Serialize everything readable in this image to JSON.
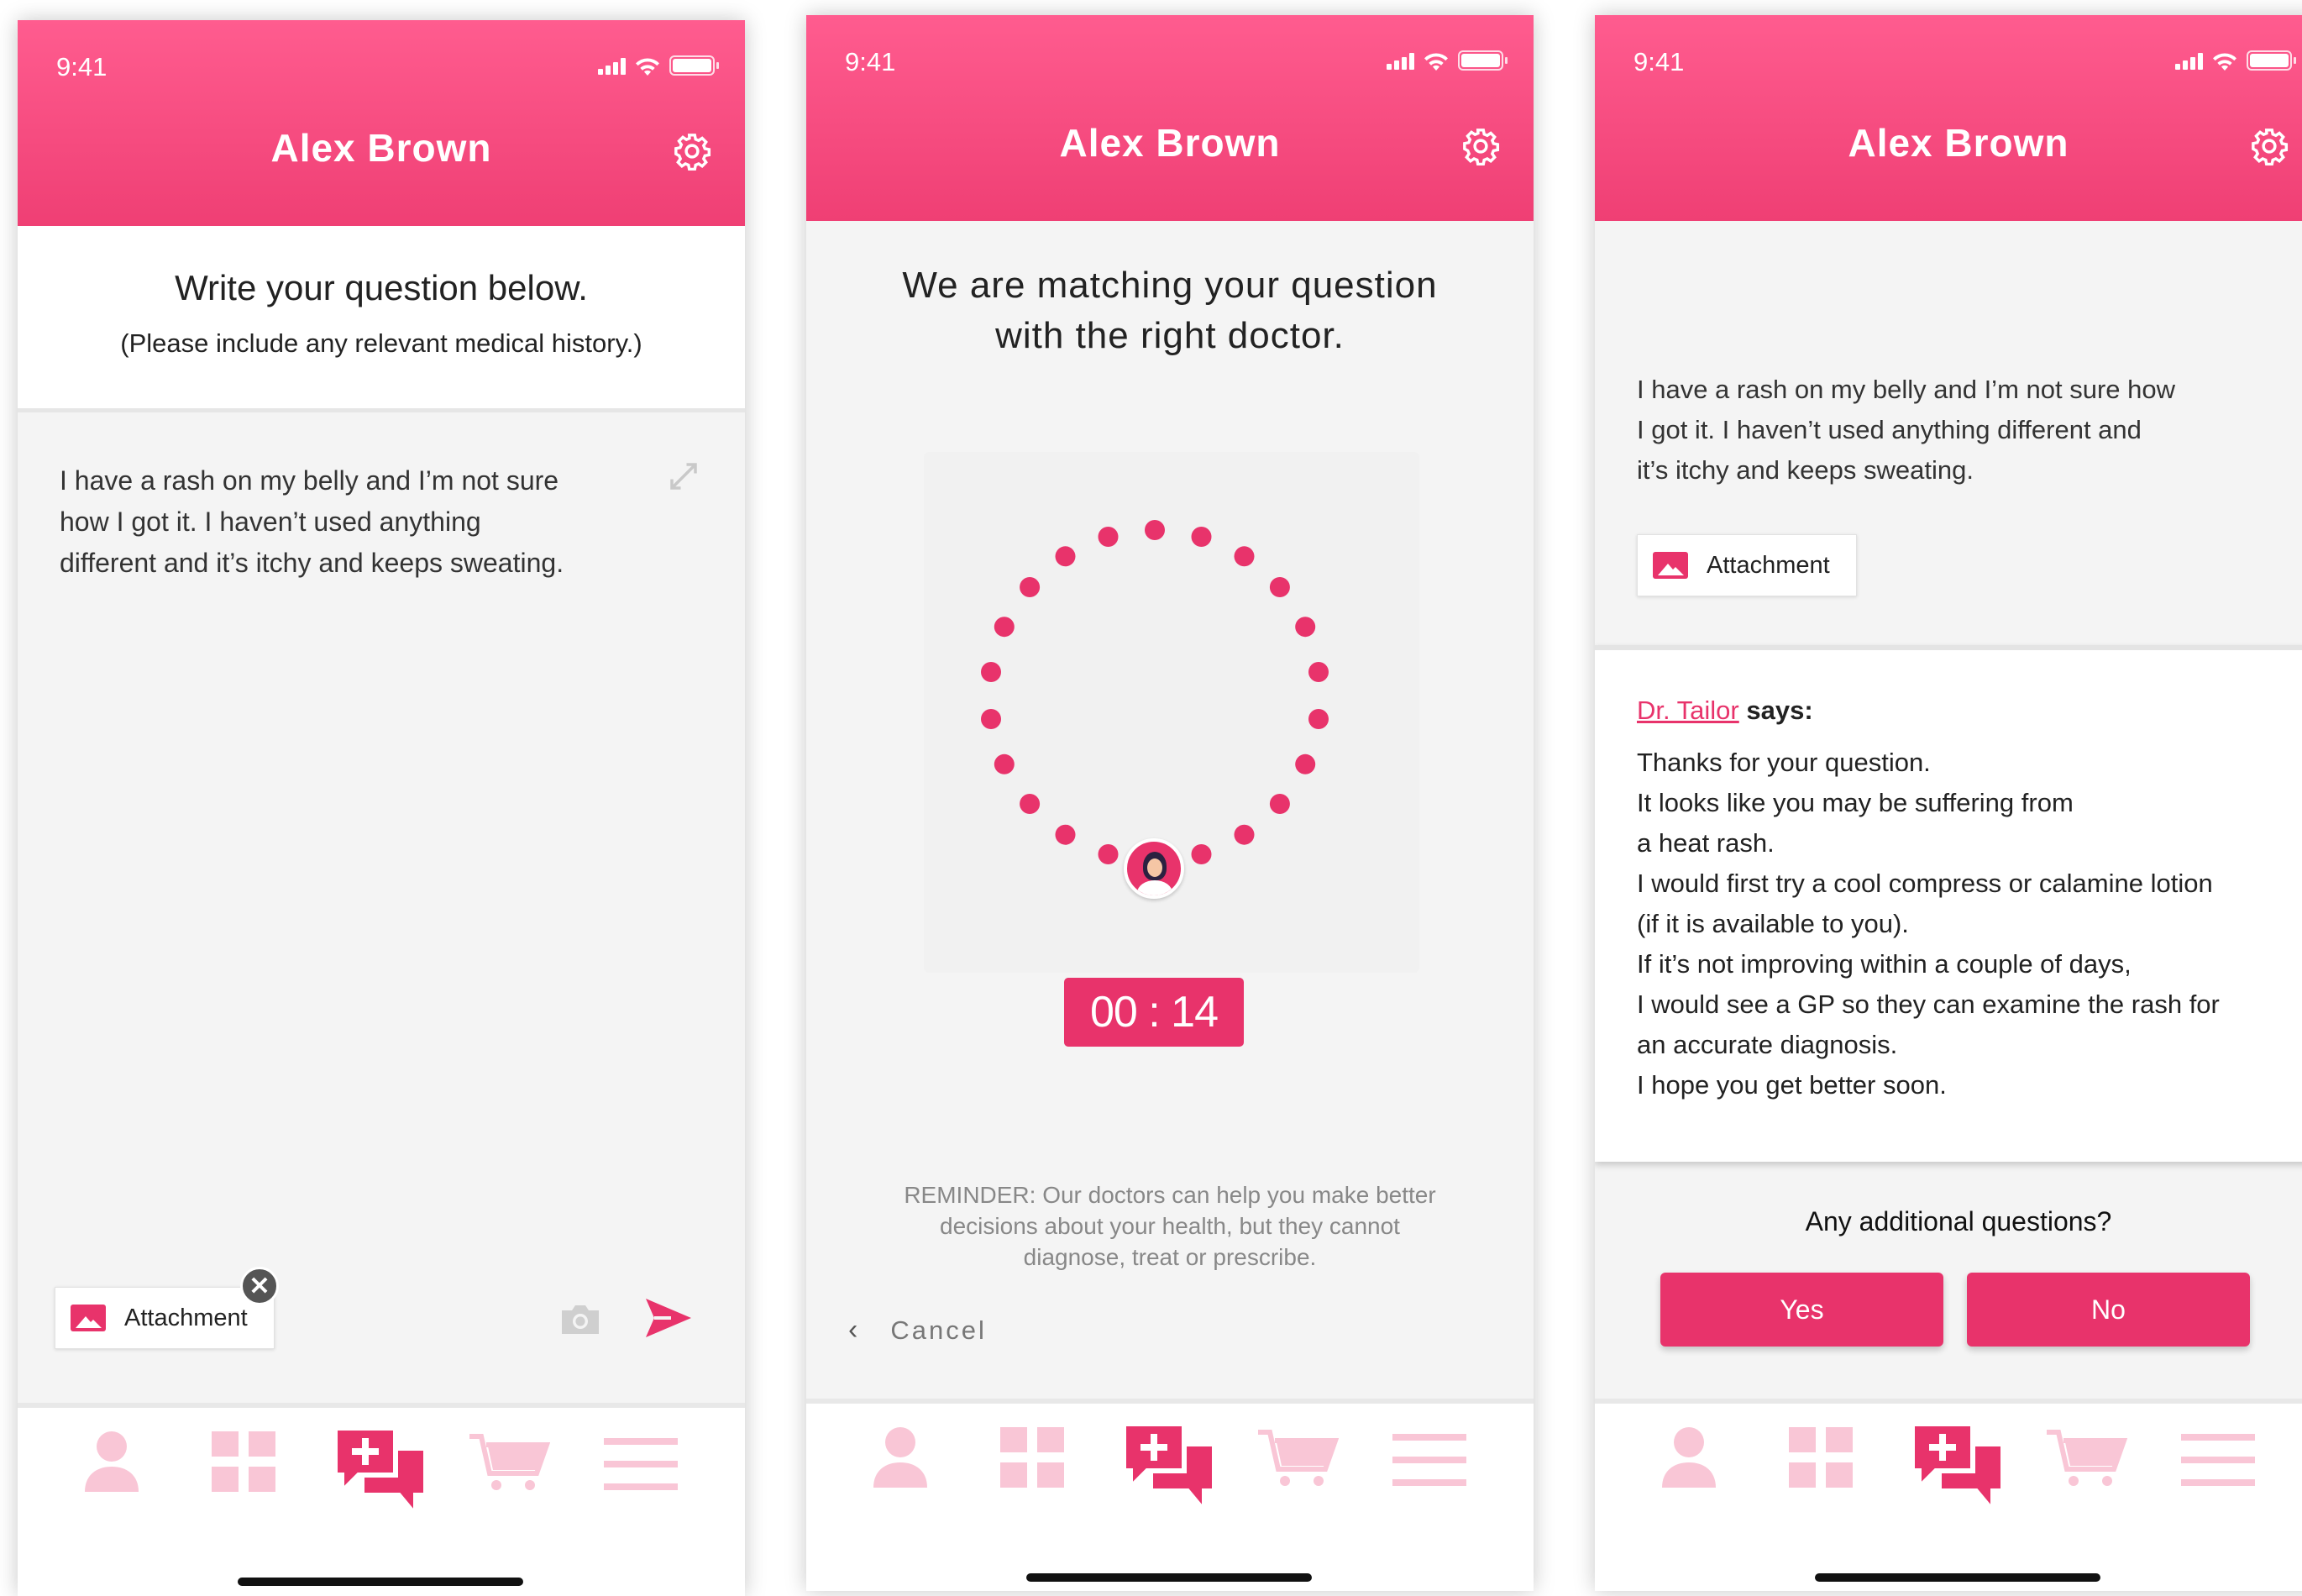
{
  "status_time": "9:41",
  "user_name": "Alex Brown",
  "colors": {
    "accent": "#e8336b",
    "header_top": "#ff5c8f",
    "header_bottom": "#ef3f74",
    "nav_icon": "#f9c6d6"
  },
  "nav_icons": [
    "person-icon",
    "grid-icon",
    "ask-doctor-icon",
    "cart-icon",
    "menu-icon"
  ],
  "screen1": {
    "heading": "Write your question below.",
    "subheading": "(Please include any relevant medical history.)",
    "question_lines": [
      "I have a rash on my belly and I’m not sure",
      "how I got it. I haven’t used anything",
      "different and it’s itchy and keeps sweating."
    ],
    "attachment_label": "Attachment"
  },
  "screen2": {
    "heading_lines": [
      "We are matching your question",
      "with the right doctor."
    ],
    "timer": "00 : 14",
    "reminder_lines": [
      "REMINDER: Our doctors can help you make better",
      "decisions about your health, but they cannot",
      "diagnose, treat or prescribe."
    ],
    "cancel_label": "Cancel"
  },
  "screen3": {
    "question_lines": [
      "I have a rash on my belly and I’m not sure how",
      "I got it. I haven’t used anything different and",
      "it’s itchy and keeps sweating."
    ],
    "attachment_label": "Attachment",
    "doctor_name": "Dr. Tailor",
    "says_label": "says:",
    "reply_lines": [
      "Thanks for your question.",
      "It looks like you may be suffering from",
      "a heat rash.",
      "I would first try a cool compress or calamine lotion",
      "(if it is available to you).",
      "If it’s not improving within a couple of days,",
      "I would see a GP so they can examine the rash for",
      "an accurate diagnosis.",
      "I hope you get better soon."
    ],
    "additional_prompt": "Any additional questions?",
    "yes_label": "Yes",
    "no_label": "No"
  }
}
